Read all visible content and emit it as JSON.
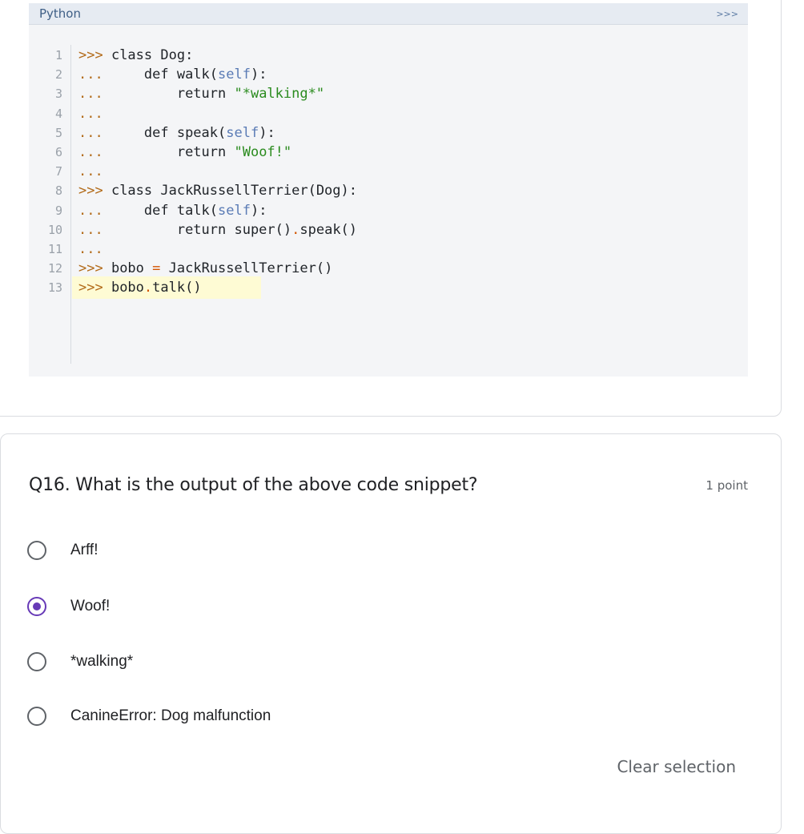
{
  "code": {
    "language": "Python",
    "shell_icon": ">>>",
    "lines": [
      {
        "num": "1",
        "parts": [
          [
            "p",
            ">>> "
          ],
          [
            "kw",
            "class Dog:"
          ]
        ]
      },
      {
        "num": "2",
        "parts": [
          [
            "p",
            "... "
          ],
          [
            "kw",
            "    def walk("
          ],
          [
            "self",
            "self"
          ],
          [
            "kw",
            "):"
          ]
        ]
      },
      {
        "num": "3",
        "parts": [
          [
            "p",
            "... "
          ],
          [
            "kw",
            "        return "
          ],
          [
            "str",
            "\"*walking*\""
          ]
        ]
      },
      {
        "num": "4",
        "parts": [
          [
            "p",
            "..."
          ]
        ]
      },
      {
        "num": "5",
        "parts": [
          [
            "p",
            "... "
          ],
          [
            "kw",
            "    def speak("
          ],
          [
            "self",
            "self"
          ],
          [
            "kw",
            "):"
          ]
        ]
      },
      {
        "num": "6",
        "parts": [
          [
            "p",
            "... "
          ],
          [
            "kw",
            "        return "
          ],
          [
            "str",
            "\"Woof!\""
          ]
        ]
      },
      {
        "num": "7",
        "parts": [
          [
            "p",
            "..."
          ]
        ]
      },
      {
        "num": "8",
        "parts": [
          [
            "p",
            ">>> "
          ],
          [
            "kw",
            "class JackRussellTerrier(Dog):"
          ]
        ]
      },
      {
        "num": "9",
        "parts": [
          [
            "p",
            "... "
          ],
          [
            "kw",
            "    def talk("
          ],
          [
            "self",
            "self"
          ],
          [
            "kw",
            "):"
          ]
        ]
      },
      {
        "num": "10",
        "parts": [
          [
            "p",
            "... "
          ],
          [
            "kw",
            "        return super()"
          ],
          [
            "dot",
            "."
          ],
          [
            "kw",
            "speak()"
          ]
        ]
      },
      {
        "num": "11",
        "parts": [
          [
            "p",
            "..."
          ]
        ]
      },
      {
        "num": "12",
        "parts": [
          [
            "p",
            ">>> "
          ],
          [
            "kw",
            "bobo "
          ],
          [
            "eq",
            "="
          ],
          [
            "kw",
            " JackRussellTerrier()"
          ]
        ]
      },
      {
        "num": "13",
        "parts": [
          [
            "p",
            ">>> "
          ],
          [
            "kw",
            "bobo"
          ],
          [
            "dot",
            "."
          ],
          [
            "kw",
            "talk()"
          ]
        ],
        "highlight": true
      }
    ]
  },
  "question": {
    "title": "Q16. What is the output of the above code snippet?",
    "points": "1 point",
    "options": [
      {
        "label": "Arff!",
        "selected": false
      },
      {
        "label": "Woof!",
        "selected": true
      },
      {
        "label": "*walking*",
        "selected": false
      },
      {
        "label": "CanineError: Dog malfunction",
        "selected": false
      }
    ],
    "clear_label": "Clear selection"
  },
  "colors": {
    "accent": "#673ab7",
    "code_bg": "#f4f5f7",
    "highlight": "#fefbd4"
  }
}
